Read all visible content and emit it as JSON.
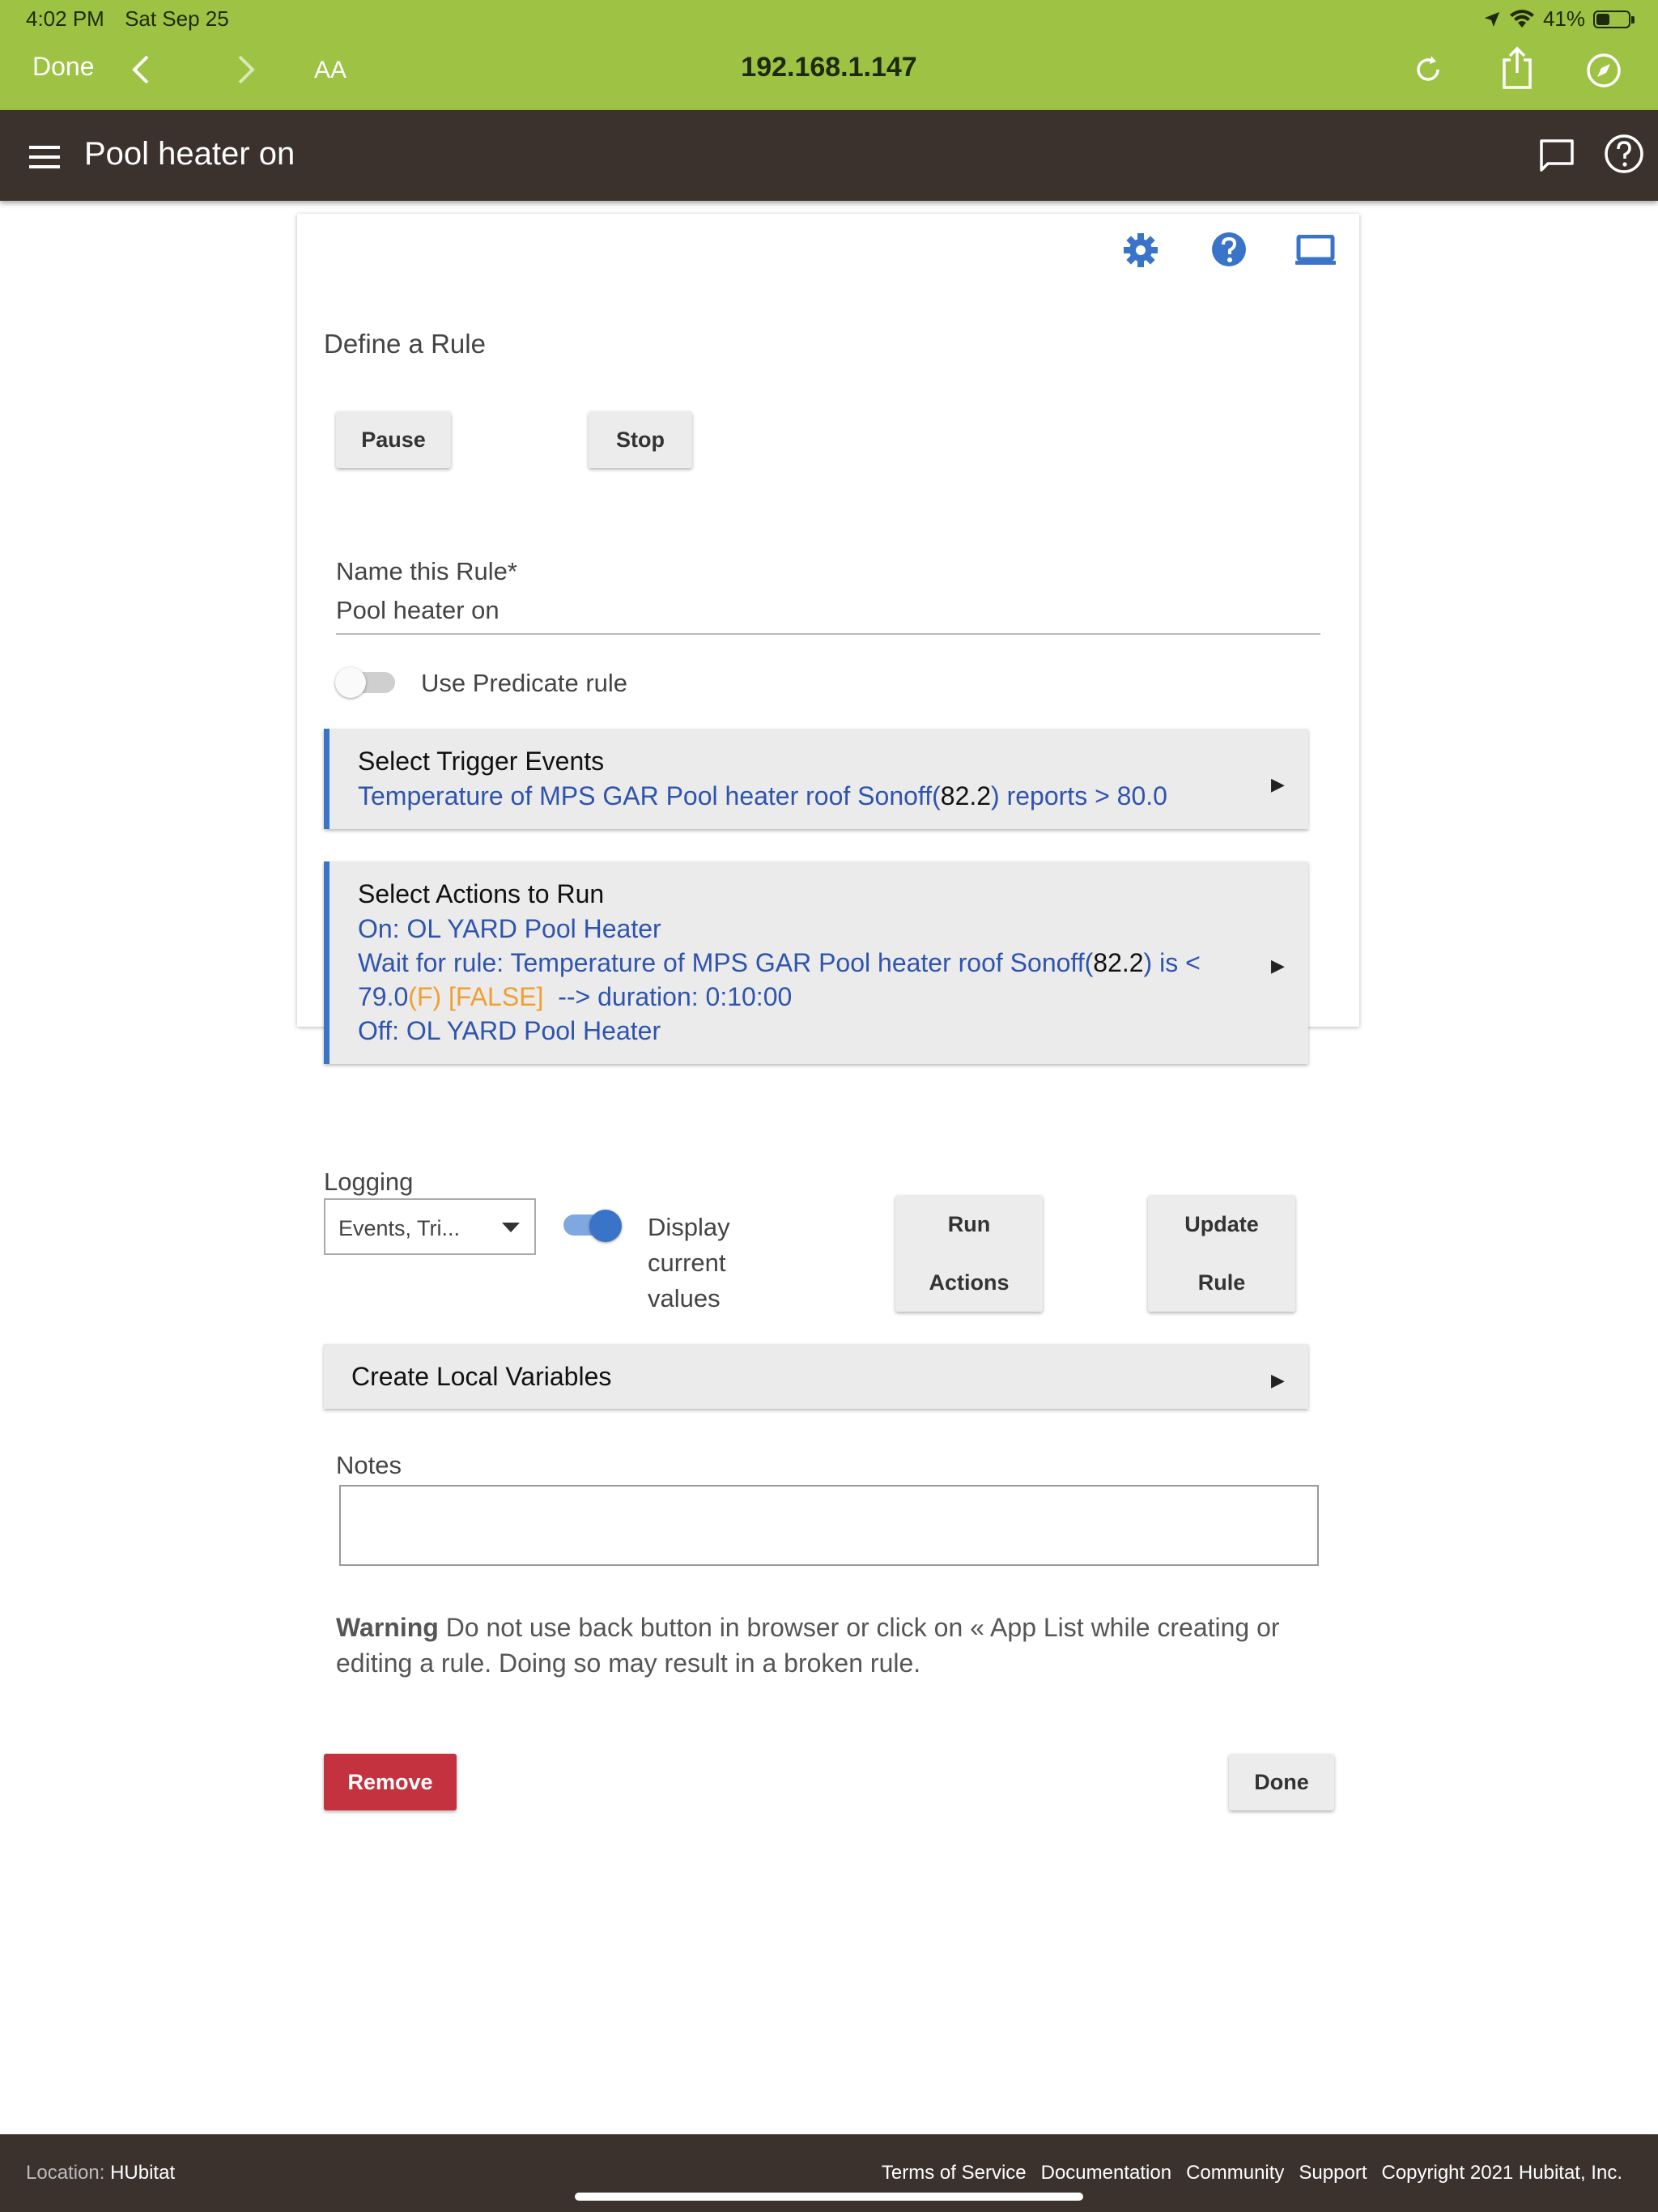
{
  "status_bar": {
    "time": "4:02 PM",
    "date": "Sat Sep 25",
    "battery": "41%",
    "battery_level": 0.41
  },
  "browser": {
    "done_label": "Done",
    "text_size_label": "AA",
    "url": "192.168.1.147"
  },
  "app_header": {
    "title": "Pool heater on"
  },
  "rule": {
    "heading": "Define a Rule",
    "pause_label": "Pause",
    "stop_label": "Stop",
    "name_label": "Name this Rule*",
    "name_value": "Pool heater on",
    "predicate_label": "Use Predicate rule",
    "predicate_enabled": false,
    "trigger": {
      "title": "Select Trigger Events",
      "line1_pre": "Temperature of MPS GAR Pool heater roof Sonoff(",
      "line1_val": "82.2",
      "line1_post": ") reports > 80.0"
    },
    "actions": {
      "title": "Select Actions to Run",
      "line1": "On: OL YARD Pool Heater",
      "line2_pre": "Wait for rule: Temperature of MPS GAR Pool heater roof Sonoff(",
      "line2_val": "82.2",
      "line2_post": ") is <",
      "line3_pre": "79.0",
      "line3_flag": "(F) [FALSE]",
      "line3_post": "  --> duration: 0:10:00",
      "line4": "Off: OL YARD Pool Heater"
    },
    "logging_label": "Logging",
    "logging_value": "Events, Tri...",
    "display_values_label_1": "Display",
    "display_values_label_2": "current",
    "display_values_label_3": "values",
    "display_values_enabled": true,
    "run_actions_1": "Run",
    "run_actions_2": "Actions",
    "update_rule_1": "Update",
    "update_rule_2": "Rule",
    "local_variables_title": "Create Local Variables",
    "notes_label": "Notes",
    "notes_value": "",
    "warning_bold": "Warning",
    "warning_text_1": " Do not use back button in browser or click on « App List while creating or",
    "warning_text_2": "editing a rule. Doing so may result in a broken rule.",
    "remove_label": "Remove",
    "done_label": "Done"
  },
  "footer": {
    "location_label": "Location:",
    "location_value": "HUbitat",
    "links": [
      "Terms of Service",
      "Documentation",
      "Community",
      "Support",
      "Copyright 2021 Hubitat, Inc."
    ]
  },
  "colors": {
    "browser_bar": "#9dc244",
    "app_bar": "#3b312d",
    "accent_blue": "#3a74c8",
    "link_blue": "#2f54ae",
    "remove_red": "#c5323f",
    "flag_orange": "#f0a030"
  }
}
